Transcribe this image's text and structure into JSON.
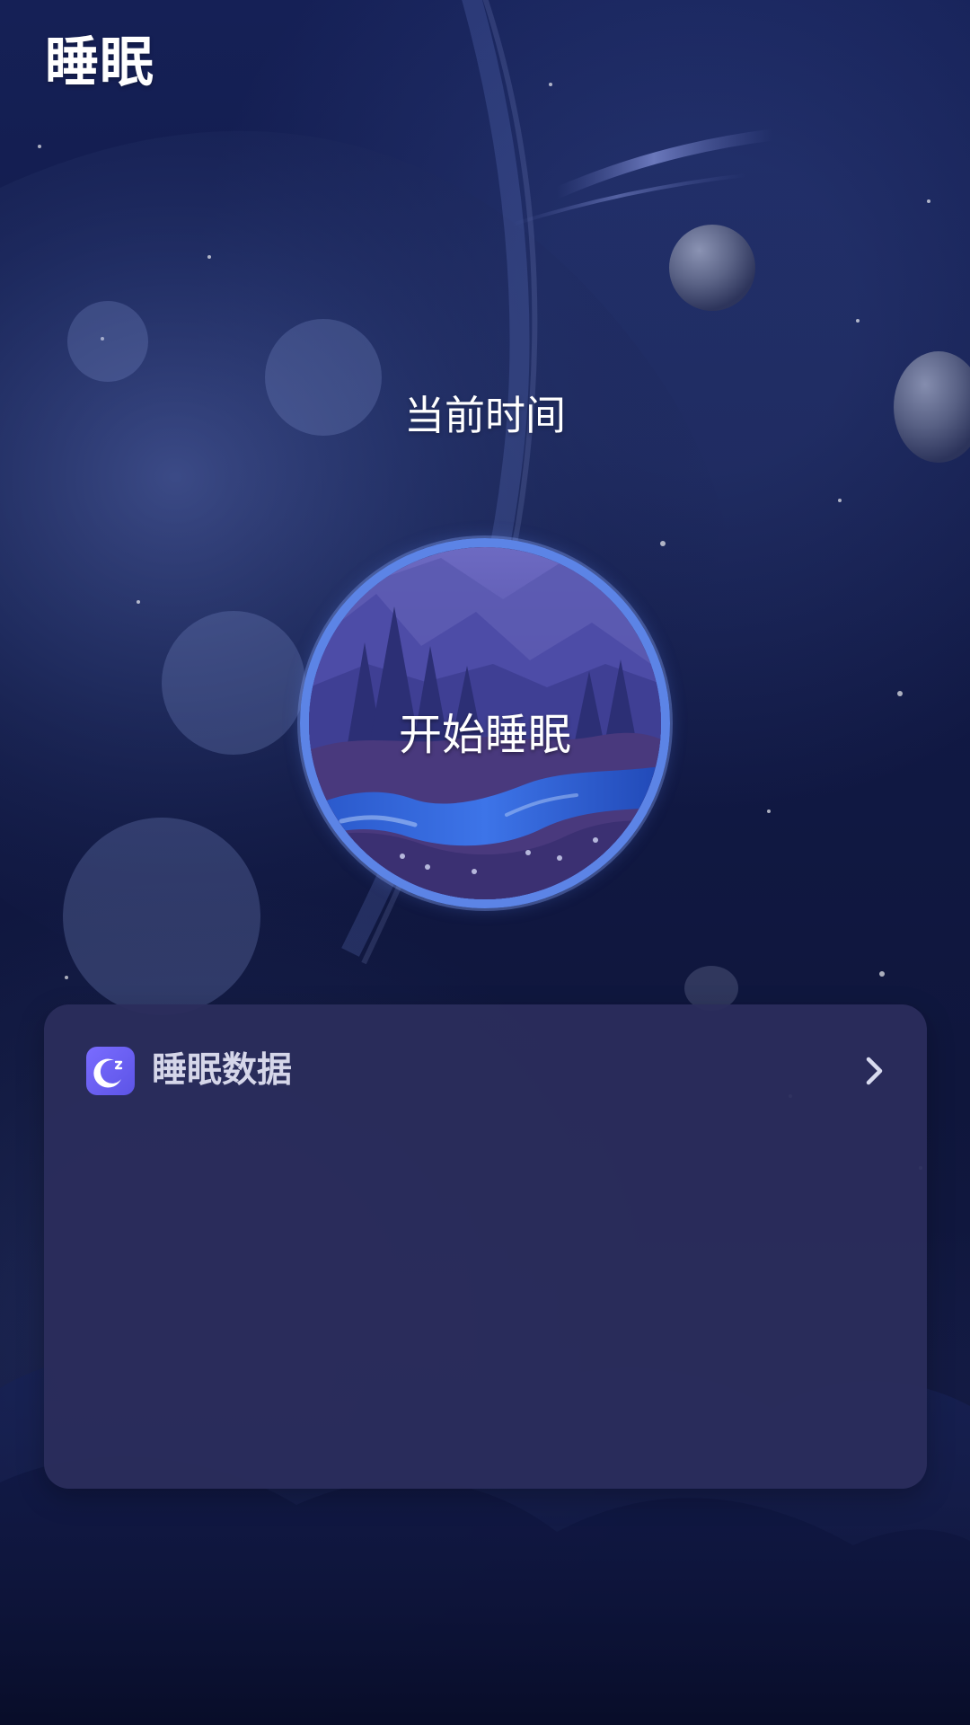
{
  "header": {
    "title": "睡眠"
  },
  "sleep": {
    "current_time_label": "当前时间",
    "start_button_label": "开始睡眠"
  },
  "sleep_data": {
    "title": "睡眠数据",
    "icon": "moon-sleep-icon",
    "chevron": "chevron-right-icon"
  },
  "colors": {
    "accent_blue": "#5c84e6",
    "card_bg": "#2b2d5c",
    "icon_purple": "#6d64ff"
  }
}
